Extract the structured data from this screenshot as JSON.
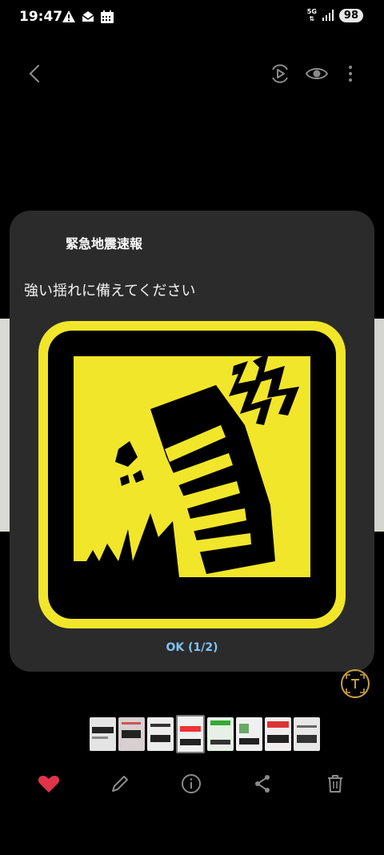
{
  "status_bar": {
    "time": "19:47",
    "network": "5G",
    "battery": "98"
  },
  "top_bar": {
    "icons": [
      "back-icon",
      "motion-photo-icon",
      "eye-icon",
      "more-icon"
    ]
  },
  "dialog": {
    "title": "緊急地震速報",
    "message": "強い揺れに備えてください",
    "ok_label": "OK  (1/2)"
  },
  "colors": {
    "warning_yellow": "#f2e62a",
    "favorite_red": "#e0344a",
    "ok_text": "#7fc4f0",
    "dialog_bg": "#2b2b2b"
  },
  "bottom_bar": {
    "icons": [
      "heart-icon",
      "edit-icon",
      "info-icon",
      "share-icon",
      "delete-icon"
    ]
  }
}
